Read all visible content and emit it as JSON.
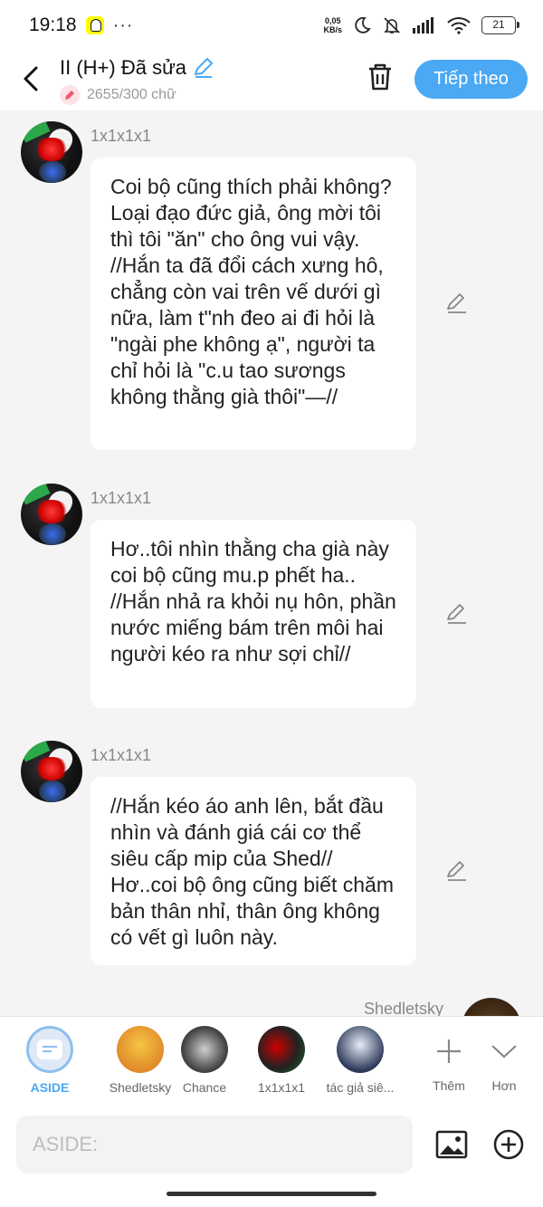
{
  "status_bar": {
    "time": "19:18",
    "dots": "···",
    "net_speed_value": "0,05",
    "net_speed_unit": "KB/s",
    "battery": "21"
  },
  "header": {
    "title": "II (H+) Đã sửa",
    "subtitle": "2655/300 chữ",
    "next_label": "Tiếp theo"
  },
  "messages": [
    {
      "sender": "1x1x1x1",
      "text": "Coi bộ cũng thích phải không? Loại đạo đức giả, ông mời tôi thì tôi \"ăn\" cho ông vui vậy. //Hắn ta đã đổi cách xưng hô, chẳng còn vai trên vế dưới gì nữa, làm t\"nh đeo ai đi hỏi là \"ngài phe không ạ\", người ta chỉ hỏi là \"c.u tao sươngs không thằng già thôi\"—//"
    },
    {
      "sender": "1x1x1x1",
      "text": "Hơ..tôi nhìn thằng cha già này coi bộ cũng mu.p phết ha.. //Hắn nhả ra khỏi nụ hôn, phần nước miếng bám trên môi hai người kéo ra như sợi chỉ//"
    },
    {
      "sender": "1x1x1x1",
      "text": "//Hắn kéo áo anh lên, bắt đầu nhìn và đánh giá cái cơ thể siêu cấp mip của Shed// Hơ..coi bộ ông cũng biết chăm bản thân nhỉ, thân ông không có vết gì luôn này."
    }
  ],
  "partial_sender": "Shedletsky",
  "characters": [
    {
      "label": "ASIDE"
    },
    {
      "label": "Shedletsky"
    },
    {
      "label": "Chance"
    },
    {
      "label": "1x1x1x1"
    },
    {
      "label": "tác giả siê..."
    }
  ],
  "controls": {
    "more_label": "Thêm",
    "less_label": "Hơn"
  },
  "input": {
    "placeholder": "ASIDE:"
  },
  "colors": {
    "accent": "#4aa8f4",
    "bubble": "#ffffff",
    "background": "#f4f4f4"
  }
}
